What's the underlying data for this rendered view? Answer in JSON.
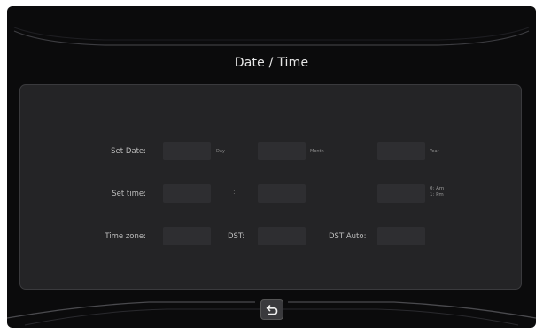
{
  "page": {
    "title": "Date / Time"
  },
  "set_date": {
    "label": "Set Date:",
    "day_unit": "Day",
    "month_unit": "Month",
    "year_unit": "Year",
    "day_value": "",
    "month_value": "",
    "year_value": ""
  },
  "set_time": {
    "label": "Set time:",
    "separator": ":",
    "am_label": "0: Am",
    "pm_label": "1: Pm",
    "hour_value": "",
    "minute_value": "",
    "ampm_value": ""
  },
  "time_zone": {
    "label": "Time zone:",
    "value": "",
    "dst_label": "DST:",
    "dst_value": "",
    "dst_auto_label": "DST Auto:",
    "dst_auto_value": ""
  },
  "footer": {
    "back_icon": "back-arrow-icon"
  }
}
